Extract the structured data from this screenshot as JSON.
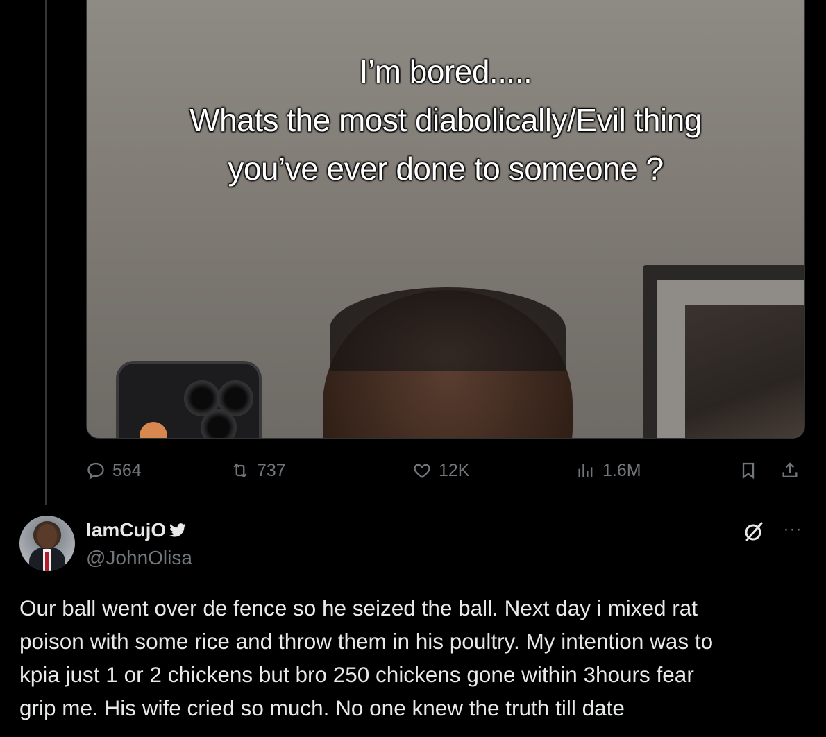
{
  "media": {
    "caption_lines": [
      "I’m bored.....",
      "Whats the most diabolically/Evil thing",
      "you’ve ever done to someone ?"
    ]
  },
  "quoted_actions": {
    "replies": "564",
    "retweets": "737",
    "likes": "12K",
    "views": "1.6M"
  },
  "reply": {
    "display_name": "IamCujO",
    "handle": "@JohnOlisa",
    "more": "···",
    "text_lines": [
      "Our ball went over de fence so he seized the ball. Next day i mixed rat",
      "poison with some rice and throw them in his poultry. My intention was to",
      "kpia just 1 or 2 chickens but bro 250 chickens gone within 3hours fear",
      "grip me. His wife cried so much. No one knew the truth till date"
    ]
  },
  "icons": {
    "reply": "reply-bubble-icon",
    "retweet": "retweet-icon",
    "like": "heart-icon",
    "views": "views-bar-chart-icon",
    "bookmark": "bookmark-icon",
    "share": "share-icon",
    "verified": "bird-icon",
    "grok": "grok-icon",
    "more": "more-dots-icon"
  },
  "colors": {
    "background": "#000000",
    "text_primary": "#e7e9ea",
    "text_secondary": "#71767b"
  }
}
